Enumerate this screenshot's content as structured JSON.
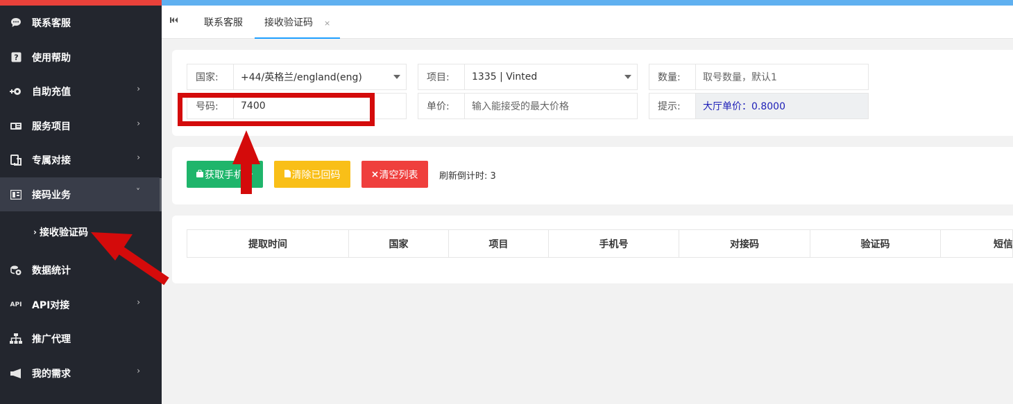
{
  "sidebar": {
    "items": [
      {
        "label": "联系客服",
        "icon": "chat-icon"
      },
      {
        "label": "使用帮助",
        "icon": "help-icon"
      },
      {
        "label": "自助充值",
        "icon": "recharge-icon",
        "chevron": "›"
      },
      {
        "label": "服务项目",
        "icon": "service-icon",
        "chevron": "›"
      },
      {
        "label": "专属对接",
        "icon": "connect-icon",
        "chevron": "›"
      },
      {
        "label": "接码业务",
        "icon": "sms-icon",
        "chevron": "˅"
      },
      {
        "label": "数据统计",
        "icon": "database-icon"
      },
      {
        "label": "API对接",
        "icon": "api-icon",
        "icon_text": "API",
        "chevron": "›"
      },
      {
        "label": "推广代理",
        "icon": "sitemap-icon"
      },
      {
        "label": "我的需求",
        "icon": "megaphone-icon",
        "chevron": "›"
      }
    ],
    "sub_item": {
      "label": "接收验证码",
      "arrow": "›"
    }
  },
  "tabs": {
    "items": [
      {
        "label": "联系客服"
      },
      {
        "label": "接收验证码",
        "close": "×"
      }
    ]
  },
  "form": {
    "country": {
      "label": "国家:",
      "value": "+44/英格兰/england(eng)"
    },
    "project": {
      "label": "项目:",
      "value": "1335 | Vinted"
    },
    "quantity": {
      "label": "数量:",
      "placeholder": "取号数量，默认1"
    },
    "number": {
      "label": "号码:",
      "value": "7400"
    },
    "price": {
      "label": "单价:",
      "placeholder": "输入能接受的最大价格"
    },
    "hint": {
      "label": "提示:",
      "value": "大厅单价：0.8000"
    }
  },
  "actions": {
    "get_phone": "获取手机号",
    "clear_returned": "清除已回码",
    "clear_list": "清空列表",
    "countdown": "刷新倒计时: 3"
  },
  "table": {
    "headers": [
      "提取时间",
      "国家",
      "项目",
      "手机号",
      "对接码",
      "验证码",
      "短信"
    ]
  },
  "colors": {
    "sidebar_bg": "#23262e",
    "accent_red": "#d40b0b",
    "green": "#1fb56b",
    "yellow": "#f9bf18",
    "red": "#ef3f3d",
    "tab_accent": "#1e9fff"
  }
}
